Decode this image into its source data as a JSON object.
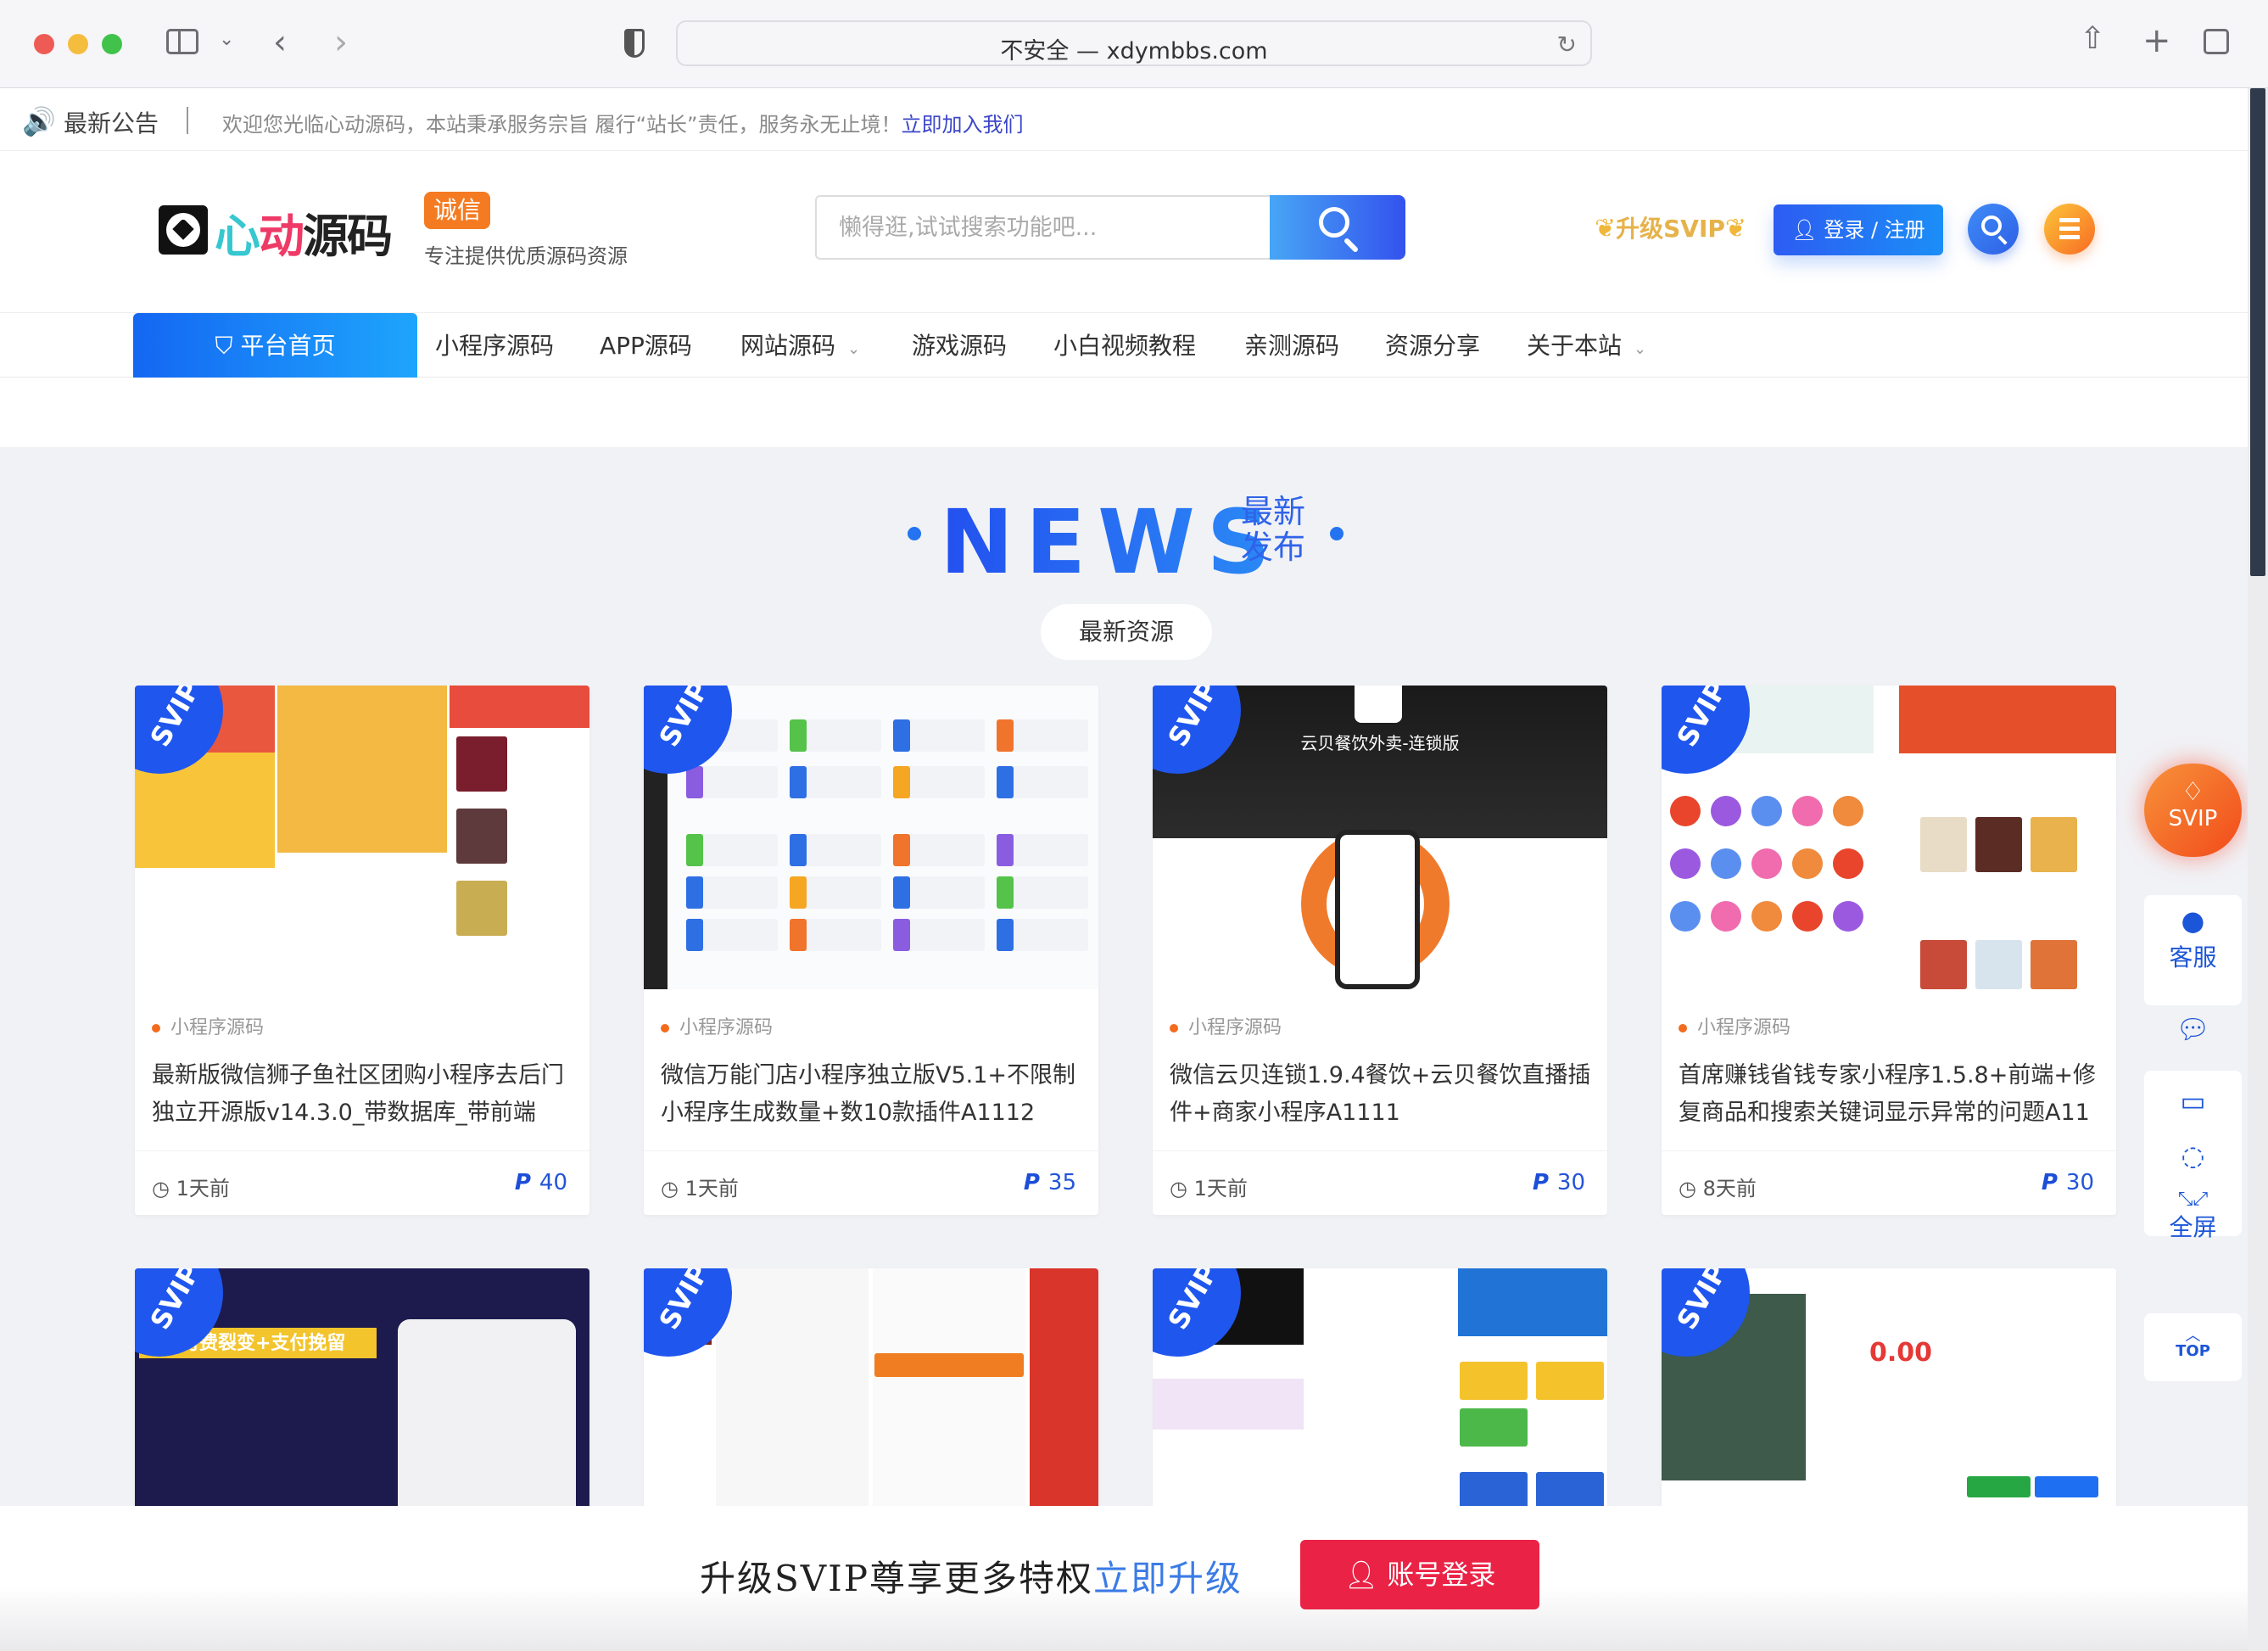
{
  "browser": {
    "url_display": "不安全 — xdymbbs.com",
    "icons": [
      "sidebar-icon",
      "chevron-down-icon",
      "back-icon",
      "forward-icon",
      "shield-icon",
      "reload-icon",
      "share-icon",
      "new-tab-icon",
      "tabs-icon"
    ]
  },
  "announcement": {
    "title": "最新公告",
    "message": "欢迎您光临心动源码，本站秉承服务宗旨 履行“站长”责任，服务永无止境！",
    "link": "立即加入我们"
  },
  "header": {
    "logo_text_1": "心",
    "logo_text_2": "动",
    "logo_text_3": "源码",
    "badge": "诚信",
    "slogan": "专注提供优质源码资源",
    "search_placeholder": "懒得逛,试试搜索功能吧...",
    "svip_upgrade": "升级SVIP",
    "login_label": "登录 / 注册"
  },
  "nav": {
    "home": "平台首页",
    "items": [
      {
        "label": "小程序源码",
        "dropdown": false
      },
      {
        "label": "APP源码",
        "dropdown": false
      },
      {
        "label": "网站源码",
        "dropdown": true
      },
      {
        "label": "游戏源码",
        "dropdown": false
      },
      {
        "label": "小白视频教程",
        "dropdown": false
      },
      {
        "label": "亲测源码",
        "dropdown": false
      },
      {
        "label": "资源分享",
        "dropdown": false
      },
      {
        "label": "关于本站",
        "dropdown": true
      }
    ]
  },
  "news": {
    "big": "NEWS",
    "sub": "最新发布",
    "pill": "最新资源"
  },
  "cards": [
    {
      "badge": "SVIP",
      "category": "小程序源码",
      "title": "最新版微信狮子鱼社区团购小程序去后门独立开源版v14.3.0_带数据库_带前端",
      "time": "1天前",
      "price": "40"
    },
    {
      "badge": "SVIP",
      "category": "小程序源码",
      "title": "微信万能门店小程序独立版V5.1+不限制小程序生成数量+数10款插件A1112",
      "time": "1天前",
      "price": "35"
    },
    {
      "badge": "SVIP",
      "category": "小程序源码",
      "title": "微信云贝连锁1.9.4餐饮+云贝餐饮直播插件+商家小程序A1111",
      "time": "1天前",
      "price": "30",
      "thumb_text": "云贝餐饮外卖-连锁版"
    },
    {
      "badge": "SVIP",
      "category": "小程序源码",
      "title": "首席赚钱省钱专家小程序1.5.8+前端+修复商品和搜索关键词显示异常的问题A11",
      "time": "8天前",
      "price": "30"
    },
    {
      "badge": "SVIP",
      "thumb_text": "精准付费裂变+支付挽留"
    },
    {
      "badge": "SVIP"
    },
    {
      "badge": "SVIP"
    },
    {
      "badge": "SVIP",
      "thumb_text": "0.00"
    }
  ],
  "float_sidebar": {
    "svip": "SVIP",
    "service": "客服",
    "fullscreen": "全屏",
    "top": "TOP"
  },
  "bottom_bar": {
    "text": "升级SVIP尊享更多特权",
    "link": "立即升级",
    "button": "账号登录"
  },
  "colors": {
    "brand_blue": "#1e6ff2",
    "accent_orange": "#f47b22",
    "login_red": "#ea2346"
  }
}
